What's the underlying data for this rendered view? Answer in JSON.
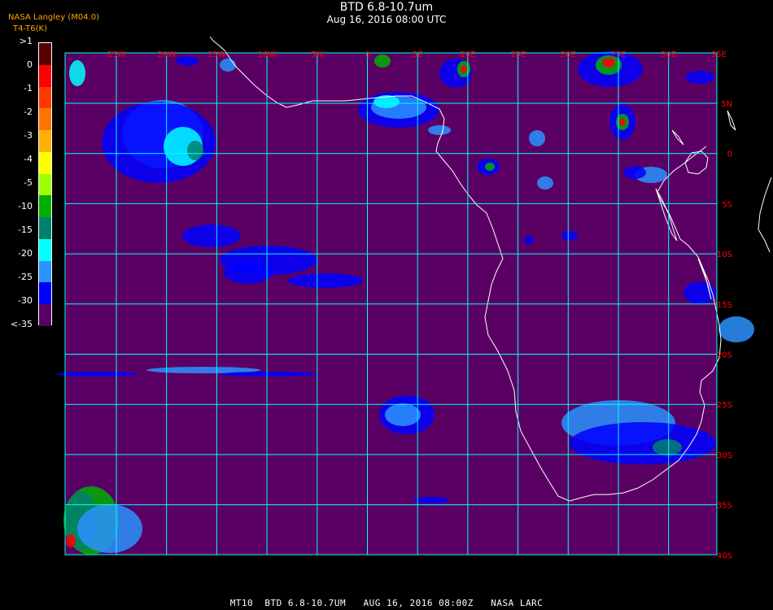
{
  "header": {
    "title": "BTD 6.8-10.7um",
    "subtitle": "Aug 16, 2016 08:00 UTC",
    "credit": "NASA Langley (M04.0)",
    "unit": "T4-T6(K)"
  },
  "legend": {
    "labels": [
      ">1",
      "0",
      "-1",
      "-2",
      "-3",
      "-4",
      "-5",
      "-10",
      "-15",
      "-20",
      "-25",
      "-30",
      "<-35"
    ],
    "colors": [
      "#5b0000",
      "#ff0000",
      "#ff3a00",
      "#ff7400",
      "#ffb000",
      "#ffff00",
      "#9eff00",
      "#00b000",
      "#00806e",
      "#00ffff",
      "#2a93ff",
      "#0000ff",
      "#5a0064"
    ]
  },
  "map": {
    "background_color": "#5a0064",
    "grid_color": "#00ffff",
    "coast_color": "#ffffff",
    "lon_labels": [
      "25W",
      "20W",
      "15W",
      "10W",
      "5W",
      "0",
      "5E",
      "10E",
      "15E",
      "20E",
      "25E",
      "30E",
      "35E"
    ],
    "lat_labels": [
      "5N",
      "0",
      "5S",
      "10S",
      "15S",
      "20S",
      "25S",
      "30S",
      "35S",
      "40S"
    ]
  },
  "footer": {
    "text": "MT10  BTD 6.8-10.7UM   AUG 16, 2016 08:00Z   NASA LARC"
  }
}
